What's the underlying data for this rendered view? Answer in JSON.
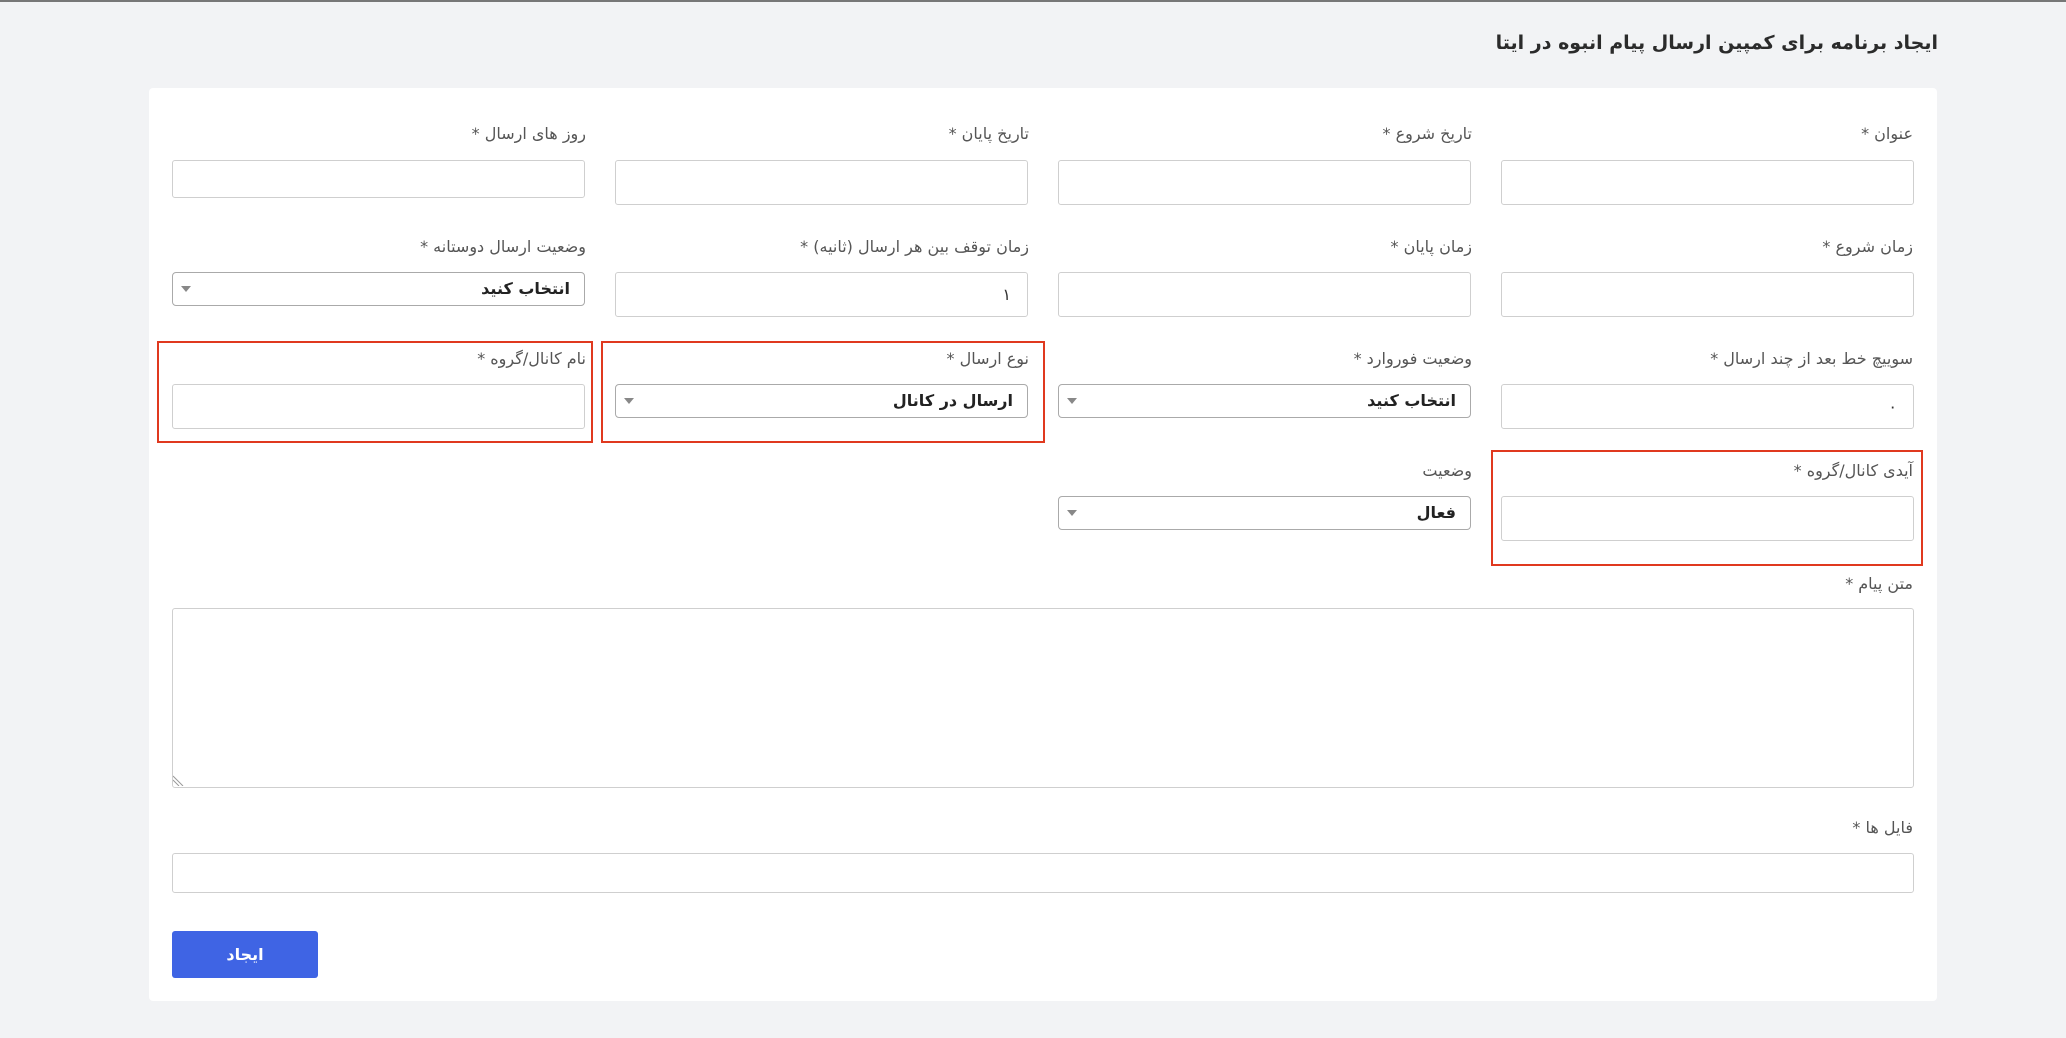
{
  "page": {
    "title": "ایجاد برنامه برای کمپین ارسال پیام انبوه در ایتا"
  },
  "form": {
    "title_label": "عنوان *",
    "start_date_label": "تاریخ شروع *",
    "end_date_label": "تاریخ پایان *",
    "send_days_label": "روز های ارسال *",
    "start_time_label": "زمان شروع *",
    "end_time_label": "زمان پایان *",
    "pause_label": "زمان توقف بین هر ارسال (ثانیه) *",
    "pause_value": "۱",
    "friendly_label": "وضعیت ارسال دوستانه *",
    "friendly_value": "انتخاب کنید",
    "switch_line_label": "سوییچ خط بعد از چند ارسال *",
    "switch_line_value": "۰",
    "forward_label": "وضعیت فوروارد *",
    "forward_value": "انتخاب کنید",
    "send_type_label": "نوع ارسال *",
    "send_type_value": "ارسال در کانال",
    "channel_name_label": "نام کانال/گروه *",
    "channel_id_label": "آیدی کانال/گروه *",
    "status_label": "وضعیت",
    "status_value": "فعال",
    "message_label": "متن پیام *",
    "files_label": "فایل ها *",
    "submit_label": "ایجاد"
  },
  "colors": {
    "highlight": "#e0391f",
    "primary_button": "#3f64e4"
  }
}
